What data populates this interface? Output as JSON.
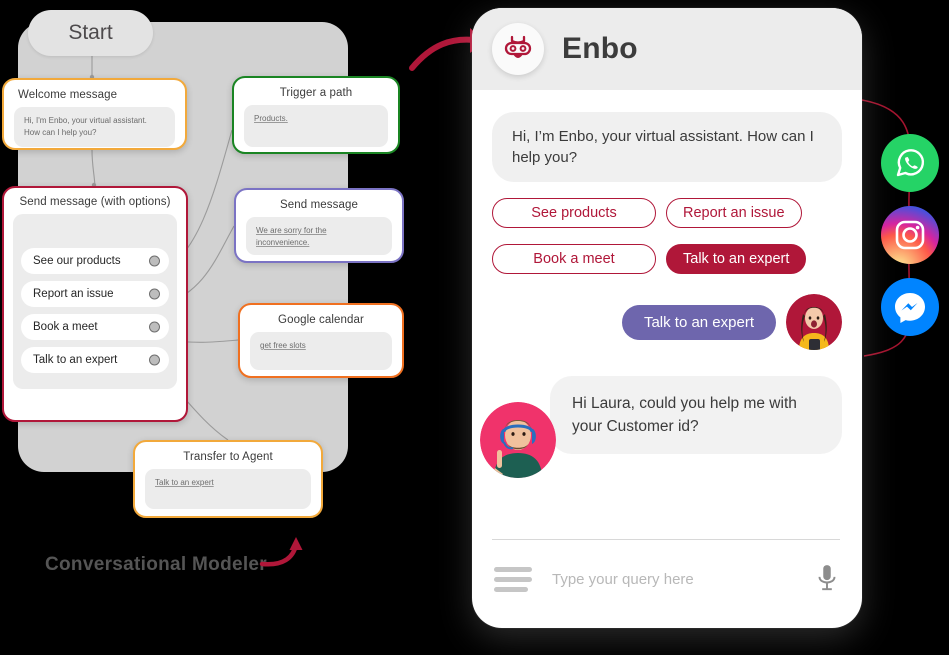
{
  "flow": {
    "start_label": "Start",
    "modeler_label": "Conversational Modeler",
    "nodes": {
      "welcome": {
        "title": "Welcome message",
        "line1": "Hi, I'm Enbo, your virtual assistant.",
        "line2": "How can I help you?",
        "border_color": "#f2a93b"
      },
      "trigger": {
        "title": "Trigger a path",
        "body": "Products.",
        "border_color": "#1a8523"
      },
      "send_message": {
        "title": "Send message",
        "body": "We are sorry for the inconvenience.",
        "border_color": "#7b73c4"
      },
      "google_calendar": {
        "title": "Google calendar",
        "body": "get free slots",
        "border_color": "#f07020"
      },
      "transfer": {
        "title": "Transfer to Agent",
        "body": "Talk to an expert",
        "border_color": "#f2a93b"
      },
      "options": {
        "title": "Send message (with options)",
        "border_color": "#b01739",
        "items": [
          {
            "label": "See our products"
          },
          {
            "label": "Report an issue"
          },
          {
            "label": "Book a meet"
          },
          {
            "label": "Talk to an expert"
          }
        ]
      }
    }
  },
  "phone": {
    "header": {
      "bot_name": "Enbo",
      "logo_icon": "robot-face-icon"
    },
    "messages": {
      "bot_greeting": "Hi, I’m Enbo, your virtual assistant. How can I help you?",
      "user_choice": "Talk to an expert",
      "agent_message": "Hi Laura, could you help me with your Customer id?"
    },
    "quick_replies": [
      {
        "label": "See products",
        "style": "outline"
      },
      {
        "label": "Report an issue",
        "style": "outline"
      },
      {
        "label": "Book a meet",
        "style": "outline"
      },
      {
        "label": "Talk to an expert",
        "style": "filled"
      }
    ],
    "input": {
      "placeholder": "Type your query here",
      "menu_icon": "hamburger-menu-icon",
      "mic_icon": "microphone-icon"
    }
  },
  "social": [
    {
      "name": "whatsapp",
      "icon": "whatsapp-icon",
      "color": "#25d366"
    },
    {
      "name": "instagram",
      "icon": "instagram-icon",
      "color": "#d6249f"
    },
    {
      "name": "messenger",
      "icon": "messenger-icon",
      "color": "#0084ff"
    }
  ],
  "colors": {
    "brand_crimson": "#b01739",
    "user_purple": "#6e66ad",
    "backdrop_gray": "#d2d2d2"
  }
}
